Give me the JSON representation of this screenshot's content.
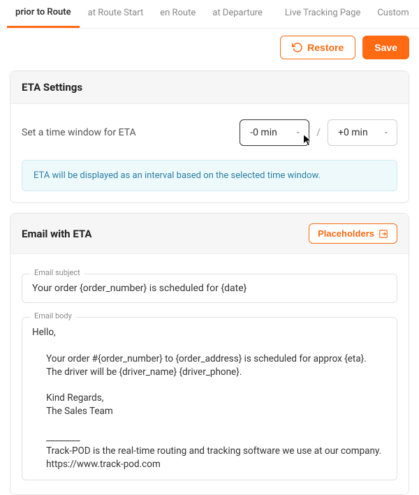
{
  "tabs": {
    "priorToRoute": "prior to Route",
    "atRouteStart": "at Route Start",
    "enRoute": "en Route",
    "atDeparture": "at Departure",
    "liveTracking": "Live Tracking Page",
    "custom": "Custom"
  },
  "actions": {
    "restore": "Restore",
    "save": "Save"
  },
  "etaSettings": {
    "title": "ETA Settings",
    "label": "Set a time window for ETA",
    "minusValue": "-0 min",
    "plusValue": "+0 min",
    "hint": "ETA will be displayed as an interval based on the selected time window."
  },
  "emailSection": {
    "title": "Email with ETA",
    "placeholdersBtn": "Placeholders",
    "subjectLegend": "Email subject",
    "subjectValue": "Your order {order_number} is scheduled for {date}",
    "bodyLegend": "Email body",
    "bodyValue": "Hello,\n\n      Your order #{order_number} to {order_address} is scheduled for approx {eta}.\n      The driver will be {driver_name} {driver_phone}.\n\n      Kind Regards,\n      The Sales Team\n\n      ________\n      Track-POD is the real-time routing and tracking software we use at our company.\n      https://www.track-pod.com"
  }
}
